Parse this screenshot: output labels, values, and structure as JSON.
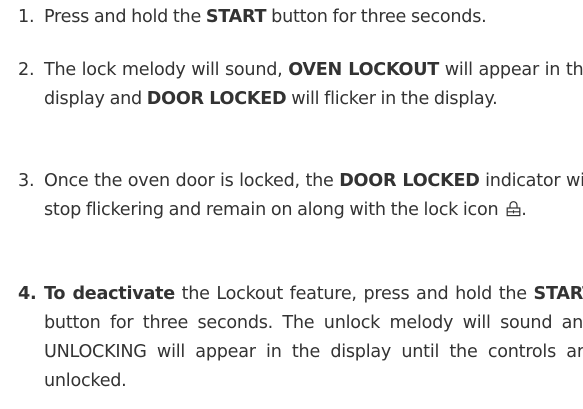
{
  "steps": [
    {
      "number": "1.",
      "parts": [
        "Press and hold the ",
        "START",
        " button for three seconds."
      ]
    },
    {
      "number": "2.",
      "parts": [
        "The lock melody will sound, ",
        "OVEN LOCKOUT",
        " will appear in the display and ",
        "DOOR LOCKED",
        " will flicker in the display."
      ]
    },
    {
      "number": "3.",
      "parts": [
        "Once the oven door is locked, the ",
        "DOOR LOCKED",
        " indicator will stop flickering and remain on along with the lock icon ",
        "."
      ],
      "icon": "lock-icon"
    },
    {
      "number": "4.",
      "parts": [
        "To deactivate",
        " the Lockout feature, press and hold the ",
        "START",
        " button for three seconds. The unlock melody will sound and UNLOCKING  will appear in the display until the controls are unlocked."
      ]
    }
  ]
}
